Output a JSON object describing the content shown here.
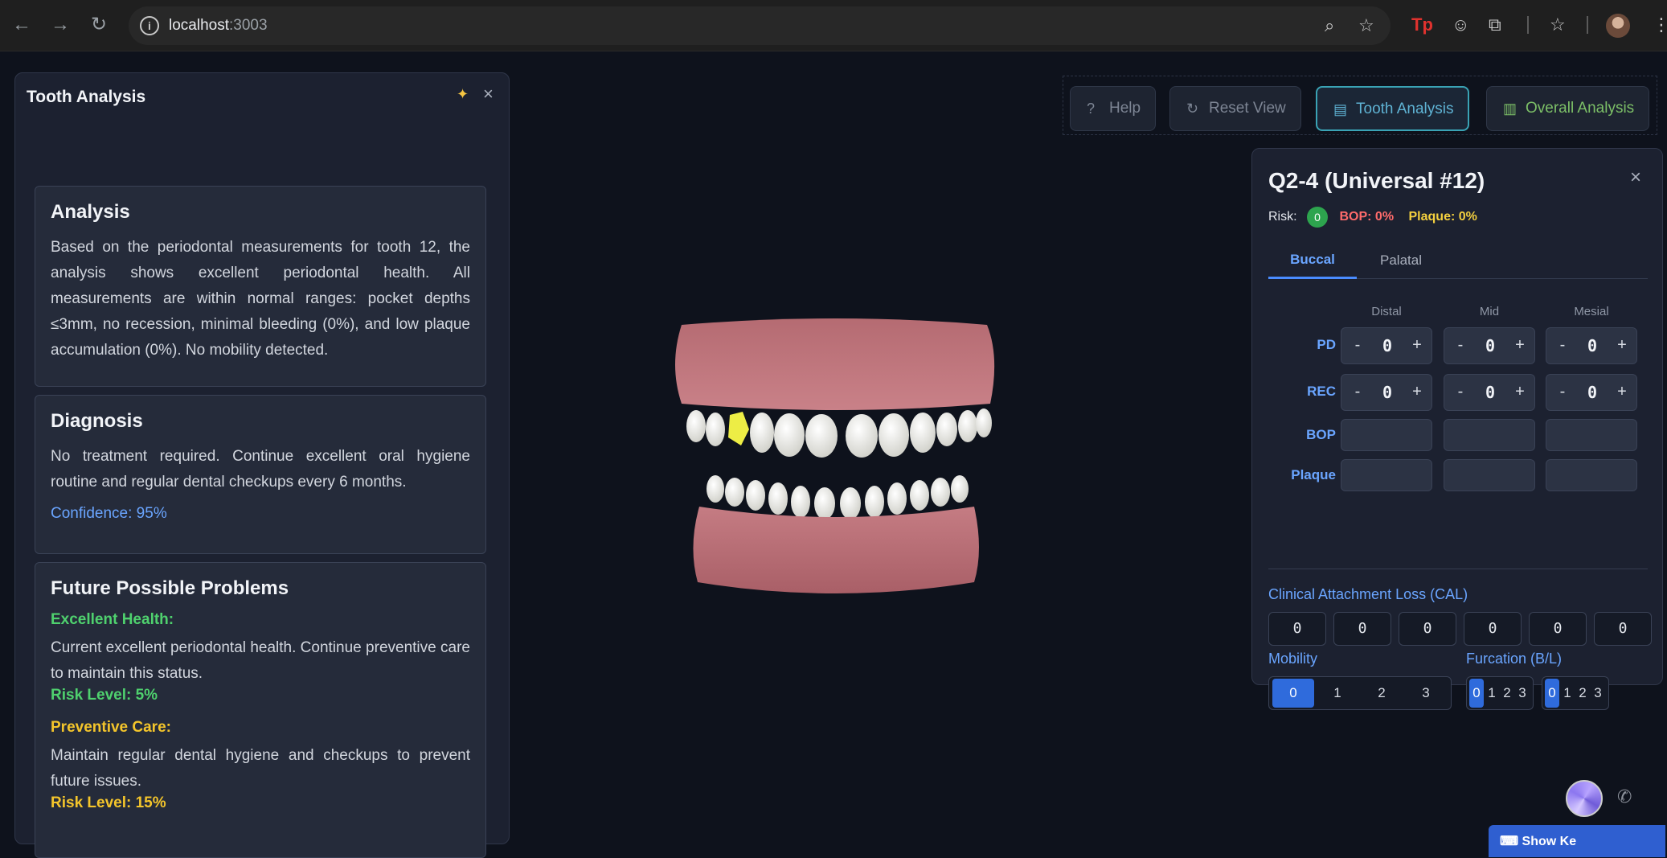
{
  "browser": {
    "url_host": "localhost",
    "url_port": ":3003"
  },
  "left_panel": {
    "title": "Tooth Analysis",
    "analysis": {
      "heading": "Analysis",
      "text": "Based on the periodontal measurements for tooth 12, the analysis shows excellent periodontal health. All measurements are within normal ranges: pocket depths ≤3mm, no recession, minimal bleeding (0%), and low plaque accumulation (0%). No mobility detected."
    },
    "diagnosis": {
      "heading": "Diagnosis",
      "text": "No treatment required. Continue excellent oral hygiene routine and regular dental checkups every 6 months.",
      "confidence": "Confidence: 95%"
    },
    "future": {
      "heading": "Future Possible Problems",
      "items": [
        {
          "title": "Excellent Health:",
          "text": "Current excellent periodontal health. Continue preventive care to maintain this status.",
          "risk": "Risk Level: 5%",
          "color": "#4fd16e"
        },
        {
          "title": "Preventive Care:",
          "text": "Maintain regular dental hygiene and checkups to prevent future issues.",
          "risk": "Risk Level: 15%",
          "color": "#f4c52b"
        }
      ]
    }
  },
  "toolbar": {
    "help": "Help",
    "reset": "Reset View",
    "tooth_analysis": "Tooth Analysis",
    "overall_analysis": "Overall Analysis"
  },
  "tooth_panel": {
    "title": "Q2-4 (Universal #12)",
    "risk_label": "Risk:",
    "risk_value": "0",
    "bop": "BOP: 0%",
    "plaque": "Plaque: 0%",
    "tabs": [
      "Buccal",
      "Palatal"
    ],
    "columns": [
      "Distal",
      "Mid",
      "Mesial"
    ],
    "rows": {
      "pd": {
        "label": "PD",
        "values": [
          "0",
          "0",
          "0"
        ]
      },
      "rec": {
        "label": "REC",
        "values": [
          "0",
          "0",
          "0"
        ]
      },
      "bop": {
        "label": "BOP"
      },
      "plaque": {
        "label": "Plaque"
      }
    },
    "cal_title": "Clinical Attachment Loss (CAL)",
    "cal_values": [
      "0",
      "0",
      "0",
      "0",
      "0",
      "0"
    ],
    "mobility_title": "Mobility",
    "mobility_options": [
      "0",
      "1",
      "2",
      "3"
    ],
    "mobility_selected": "0",
    "furcation_title": "Furcation (B/L)",
    "furcation_options": [
      "0",
      "1",
      "2",
      "3"
    ],
    "furcation_selected": [
      "0",
      "0"
    ]
  },
  "shortcuts_button": "Show Ke"
}
